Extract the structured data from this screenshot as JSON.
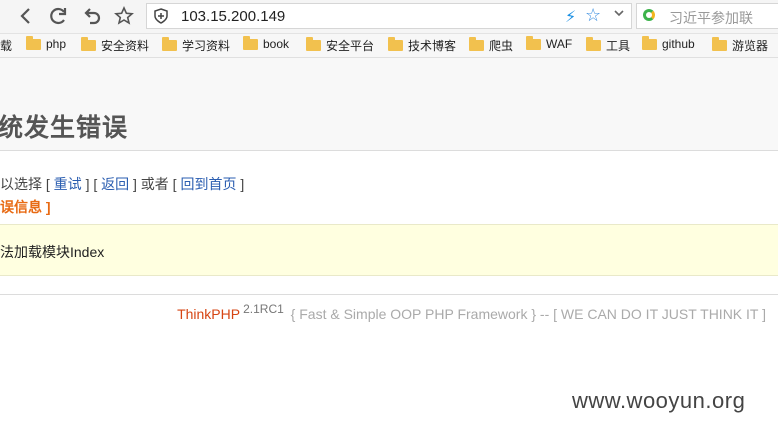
{
  "browser": {
    "url": "103.15.200.149",
    "search_placeholder": "习近平参加联",
    "bookmarks": [
      {
        "label": "载"
      },
      {
        "label": "php"
      },
      {
        "label": "安全资料"
      },
      {
        "label": "学习资料"
      },
      {
        "label": "book"
      },
      {
        "label": "安全平台"
      },
      {
        "label": "技术博客"
      },
      {
        "label": "爬虫"
      },
      {
        "label": "WAF"
      },
      {
        "label": "工具"
      },
      {
        "label": "github"
      },
      {
        "label": "游览器"
      }
    ]
  },
  "page": {
    "title": "统发生错误",
    "options_prefix": "以选择 [",
    "retry": "重试",
    "sep1": "] [",
    "back": "返回",
    "sep2": "] 或者 [",
    "home": "回到首页",
    "end": "]",
    "error_info": "误信息 ]",
    "message": "法加载模块Index",
    "footer_brand": "ThinkPHP",
    "footer_version": "2.1RC1",
    "footer_tagline": "{ Fast & Simple OOP PHP Framework } -- [ WE CAN DO IT JUST THINK IT ]",
    "watermark": "www.wooyun.org"
  }
}
